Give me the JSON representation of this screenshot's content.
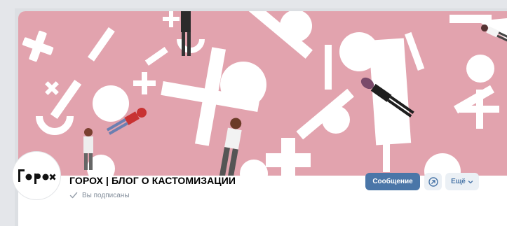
{
  "group": {
    "name": "ГОРОХ | БЛОГ О КАСТОМИЗАЦИИ",
    "subscription_status": "Вы подписаны",
    "logo_text": "Гор×"
  },
  "actions": {
    "message_label": "Сообщение",
    "more_label": "Ещё"
  },
  "icons": {
    "status": "check-icon",
    "share": "share-arrow-icon",
    "more": "chevron-down-icon"
  },
  "colors": {
    "cover_background": "#e2a3ae",
    "cover_shapes": "#ffffff",
    "primary_button": "#4a76a8",
    "secondary_button": "#ebf0f5",
    "muted_text": "#818c99"
  }
}
